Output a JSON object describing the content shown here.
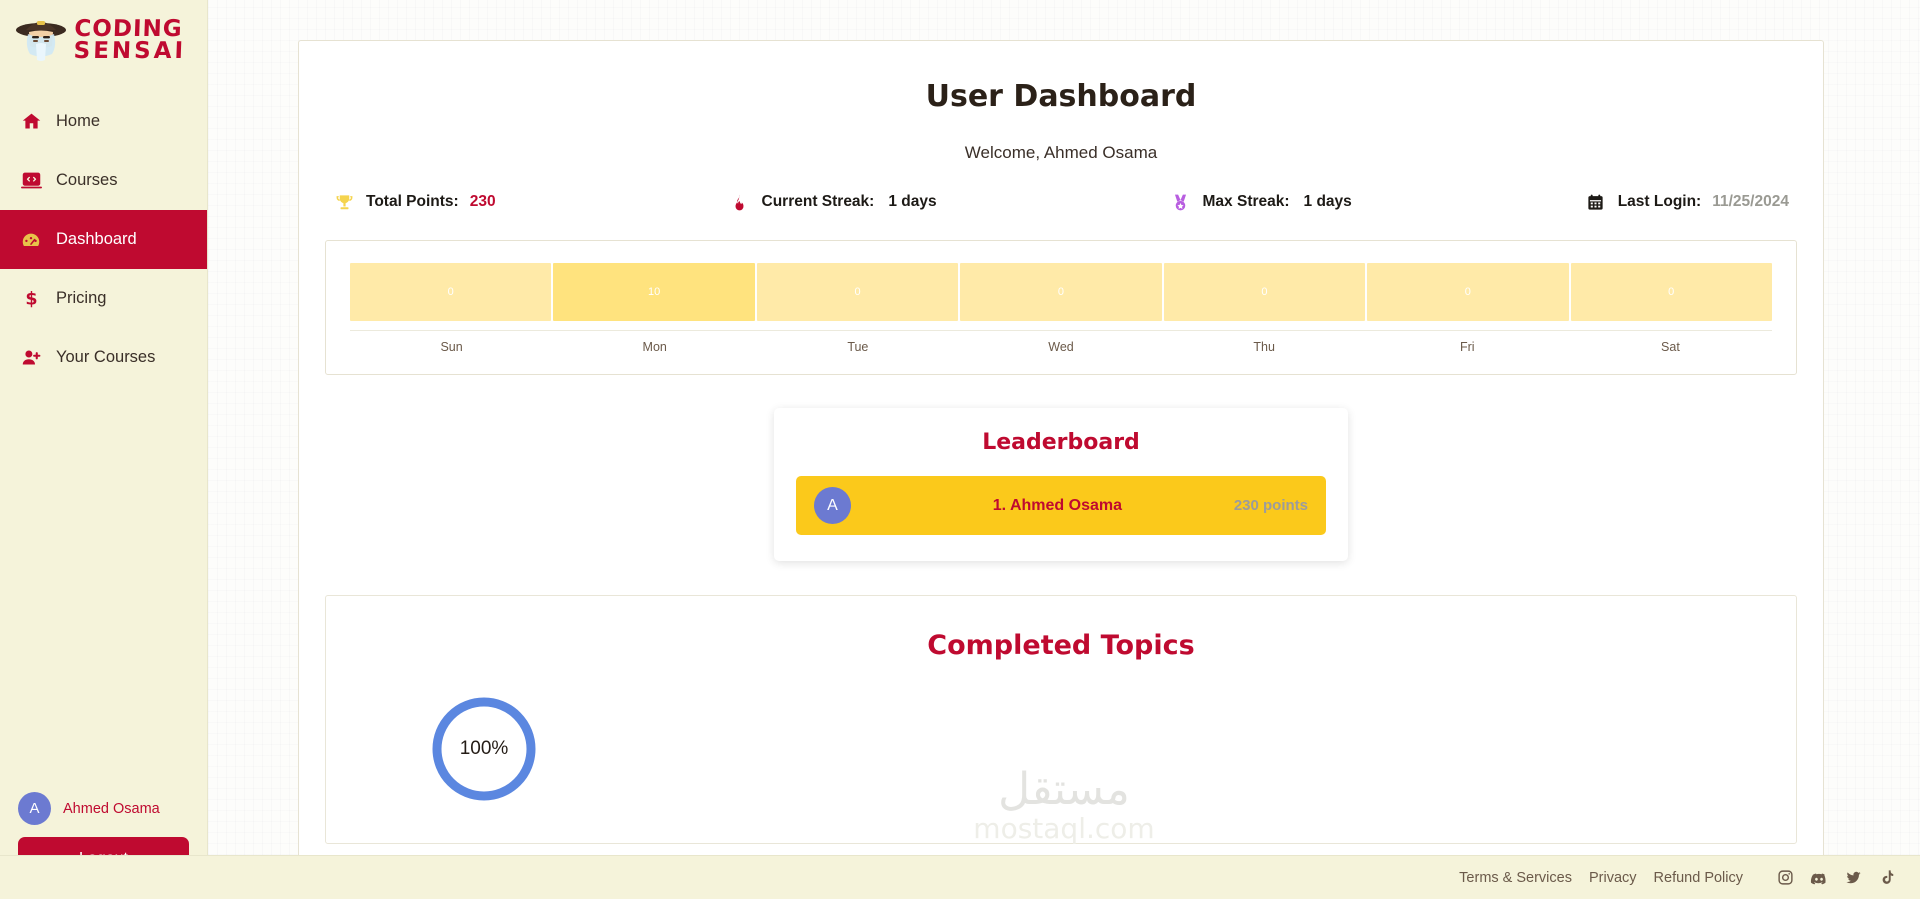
{
  "brand": {
    "line1": "CODING",
    "line2": "SENSAI",
    "logo_icon": "sensei-avatar-icon"
  },
  "sidebar": {
    "items": [
      {
        "label": "Home",
        "icon": "home-icon",
        "active": false
      },
      {
        "label": "Courses",
        "icon": "laptop-code-icon",
        "active": false
      },
      {
        "label": "Dashboard",
        "icon": "gauge-icon",
        "active": true
      },
      {
        "label": "Pricing",
        "icon": "dollar-icon",
        "active": false
      },
      {
        "label": "Your Courses",
        "icon": "user-plus-icon",
        "active": false
      }
    ],
    "user": {
      "initial": "A",
      "name": "Ahmed Osama"
    },
    "logout_label": "Logout"
  },
  "header": {
    "title": "User Dashboard",
    "welcome": "Welcome, Ahmed Osama"
  },
  "stats": [
    {
      "icon": "trophy-icon",
      "label": "Total Points:",
      "value": "230",
      "value_style": "red"
    },
    {
      "icon": "fire-icon",
      "label": "Current Streak:",
      "value": "1 days",
      "value_style": "dark"
    },
    {
      "icon": "medal-icon",
      "label": "Max Streak:",
      "value": "1 days",
      "value_style": "dark"
    },
    {
      "icon": "calendar-icon",
      "label": "Last Login:",
      "value": "11/25/2024",
      "value_style": "muted"
    }
  ],
  "chart_data": {
    "type": "bar",
    "title": "",
    "xlabel": "",
    "ylabel": "",
    "categories": [
      "Sun",
      "Mon",
      "Tue",
      "Wed",
      "Thu",
      "Fri",
      "Sat"
    ],
    "values": [
      0,
      10,
      0,
      0,
      0,
      0,
      0
    ],
    "value_labels": [
      "0",
      "10",
      "0",
      "0",
      "0",
      "0",
      "0"
    ],
    "ylim": [
      0,
      10
    ],
    "grid": false,
    "legend": "none",
    "bar_color_active": "#ffe37e",
    "bar_color_inactive": "#ffeaa8",
    "label_color": "#ffffff"
  },
  "leaderboard": {
    "title": "Leaderboard",
    "rows": [
      {
        "initial": "A",
        "name": "1. Ahmed Osama",
        "points": "230 points"
      }
    ]
  },
  "topics": {
    "title": "Completed Topics",
    "progress_percent": "100%",
    "progress_value": 100,
    "ring_color": "#5b87e0"
  },
  "watermark": {
    "arabic": "مستقل",
    "latin": "mostaql.com"
  },
  "footer": {
    "links": [
      "Terms & Services",
      "Privacy",
      "Refund Policy"
    ],
    "socials": [
      "instagram-icon",
      "discord-icon",
      "twitter-icon",
      "tiktok-icon"
    ]
  },
  "colors": {
    "brand_red": "#bf0a30",
    "sidebar_cream": "#f5f3da",
    "gold": "#fbc91b",
    "avatar_blue": "#6c7ad1"
  }
}
